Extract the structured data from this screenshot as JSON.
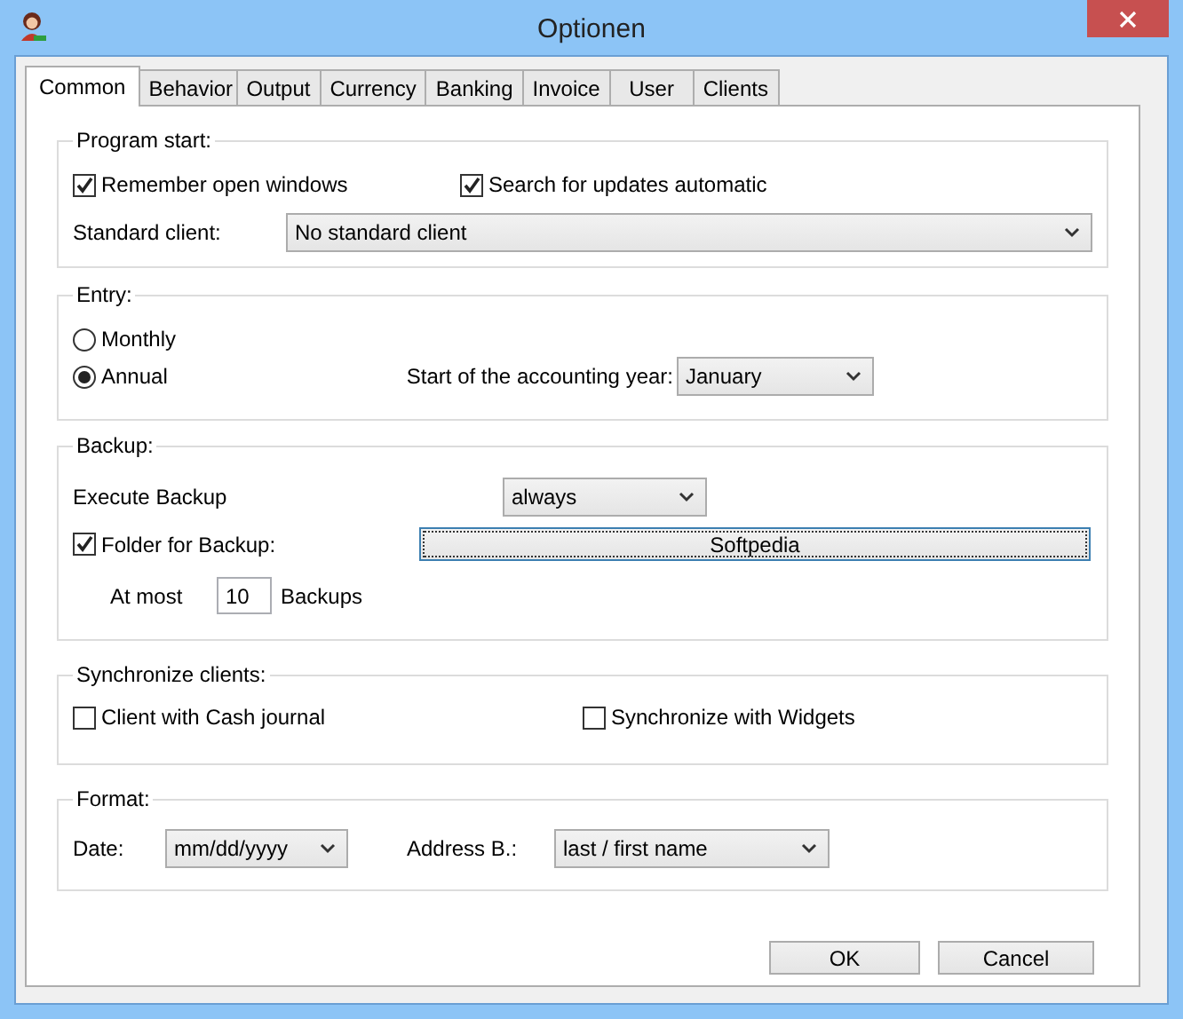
{
  "window": {
    "title": "Optionen"
  },
  "tabs": [
    {
      "label": "Common",
      "selected": true
    },
    {
      "label": "Behavior",
      "selected": false
    },
    {
      "label": "Output",
      "selected": false
    },
    {
      "label": "Currency",
      "selected": false
    },
    {
      "label": "Banking",
      "selected": false
    },
    {
      "label": "Invoice",
      "selected": false
    },
    {
      "label": "User",
      "selected": false
    },
    {
      "label": "Clients",
      "selected": false
    }
  ],
  "program_start": {
    "title": "Program start:",
    "remember_open_windows": {
      "label": "Remember open windows",
      "checked": true
    },
    "search_updates": {
      "label": "Search for updates automatic",
      "checked": true
    },
    "standard_client": {
      "label": "Standard client:",
      "value": "No standard client"
    }
  },
  "entry": {
    "title": "Entry:",
    "options": [
      {
        "label": "Monthly",
        "selected": false
      },
      {
        "label": "Annual",
        "selected": true
      }
    ],
    "accounting_year": {
      "label": "Start of the accounting year:",
      "value": "January"
    }
  },
  "backup": {
    "title": "Backup:",
    "execute": {
      "label": "Execute Backup",
      "value": "always"
    },
    "folder": {
      "label": "Folder for Backup:",
      "checked": true,
      "button": "Softpedia"
    },
    "at_most": {
      "label": "At most",
      "value": "10",
      "suffix": "Backups"
    }
  },
  "synchronize": {
    "title": "Synchronize clients:",
    "options": [
      {
        "label": "Client with Cash journal",
        "checked": false
      },
      {
        "label": "Synchronize with Widgets",
        "checked": false
      }
    ]
  },
  "format": {
    "title": "Format:",
    "date": {
      "label": "Date:",
      "value": "mm/dd/yyyy"
    },
    "address": {
      "label": "Address B.:",
      "value": "last / first name"
    }
  },
  "buttons": [
    "OK",
    "Cancel"
  ]
}
